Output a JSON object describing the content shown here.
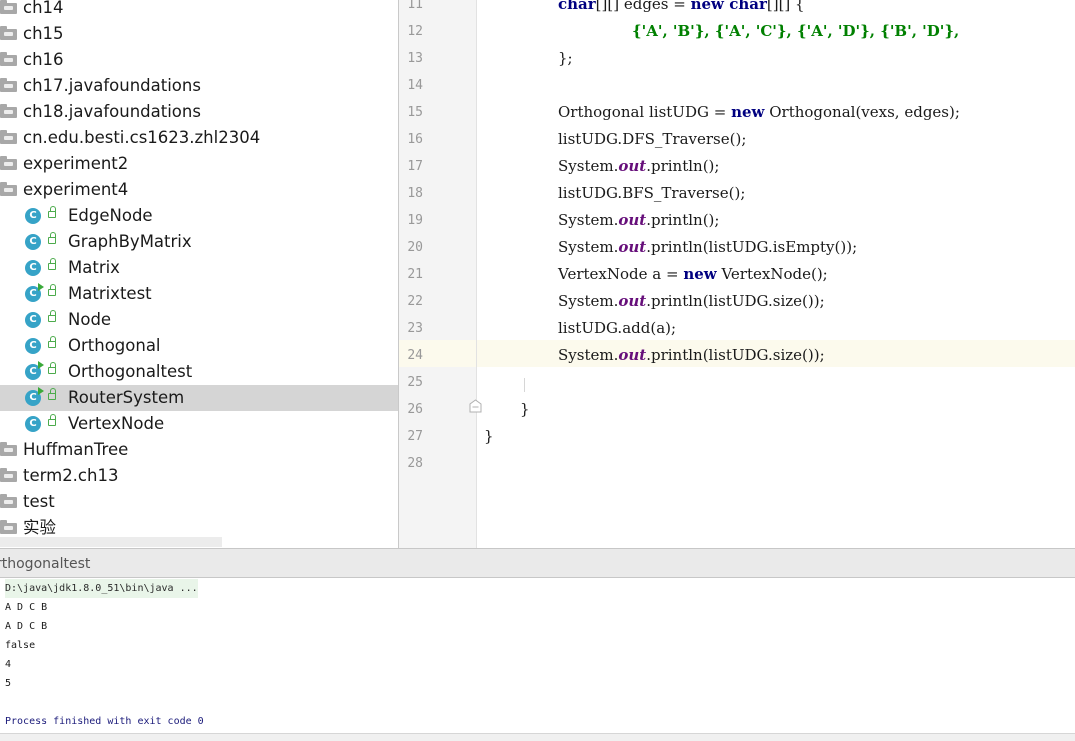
{
  "project_tree": {
    "rows": [
      {
        "label": "ch14",
        "type": "folder"
      },
      {
        "label": "ch15",
        "type": "folder"
      },
      {
        "label": "ch16",
        "type": "folder"
      },
      {
        "label": "ch17.javafoundations",
        "type": "folder"
      },
      {
        "label": "ch18.javafoundations",
        "type": "folder"
      },
      {
        "label": "cn.edu.besti.cs1623.zhl2304",
        "type": "folder"
      },
      {
        "label": "experiment2",
        "type": "folder"
      },
      {
        "label": "experiment4",
        "type": "folder"
      },
      {
        "label": "EdgeNode",
        "type": "class"
      },
      {
        "label": "GraphByMatrix",
        "type": "class"
      },
      {
        "label": "Matrix",
        "type": "class"
      },
      {
        "label": "Matrixtest",
        "type": "class-runnable"
      },
      {
        "label": "Node",
        "type": "class"
      },
      {
        "label": "Orthogonal",
        "type": "class"
      },
      {
        "label": "Orthogonaltest",
        "type": "class-runnable"
      },
      {
        "label": "RouterSystem",
        "type": "class-runnable",
        "selected": true
      },
      {
        "label": "VertexNode",
        "type": "class"
      },
      {
        "label": "HuffmanTree",
        "type": "folder"
      },
      {
        "label": "term2.ch13",
        "type": "folder"
      },
      {
        "label": "test",
        "type": "folder"
      },
      {
        "label": "实验",
        "type": "folder"
      }
    ],
    "class_icon_letter": "C",
    "icons": {
      "folder": "folder-icon",
      "class": "class-icon",
      "lock": "lock-icon"
    }
  },
  "editor": {
    "line_numbers": [
      "11",
      "12",
      "13",
      "14",
      "15",
      "16",
      "17",
      "18",
      "19",
      "20",
      "21",
      "22",
      "23",
      "24",
      "25",
      "26",
      "27",
      "28"
    ],
    "current_line": "24",
    "lines": {
      "l11": {
        "kw1": "char",
        "p1": "[][] edges = ",
        "kw2": "new",
        "kw3": " char",
        "p2": "[][] {"
      },
      "l12": "{'A', 'B'}, {'A', 'C'}, {'A', 'D'}, {'B', 'D'},",
      "l13": "};",
      "l15": {
        "p1": "Orthogonal listUDG = ",
        "kw": "new",
        "p2": " Orthogonal(vexs, edges);"
      },
      "l16": "listUDG.DFS_Traverse();",
      "l17": {
        "p1": "System.",
        "fld": "out",
        "p2": ".println();"
      },
      "l18": "listUDG.BFS_Traverse();",
      "l19": {
        "p1": "System.",
        "fld": "out",
        "p2": ".println();"
      },
      "l20": {
        "p1": "System.",
        "fld": "out",
        "p2": ".println(listUDG.isEmpty());"
      },
      "l21": {
        "p1": "VertexNode a = ",
        "kw": "new",
        "p2": " VertexNode();"
      },
      "l22": {
        "p1": "System.",
        "fld": "out",
        "p2": ".println(listUDG.size());"
      },
      "l23": "listUDG.add(a);",
      "l24": {
        "p1": "System.",
        "fld": "out",
        "p2": ".println(listUDG.size());"
      },
      "l26": "}",
      "l27": "}"
    }
  },
  "run_panel": {
    "title": "rthogonaltest",
    "command": "D:\\java\\jdk1.8.0_51\\bin\\java ...",
    "output": [
      "A D C B",
      "A D C B",
      "false",
      "4",
      "5"
    ],
    "exit": "Process finished with exit code 0"
  },
  "colors": {
    "keyword": "#000080",
    "field": "#660e7a",
    "string": "#008000",
    "selection": "#d5d5d5",
    "current_line": "#fcfaed"
  }
}
